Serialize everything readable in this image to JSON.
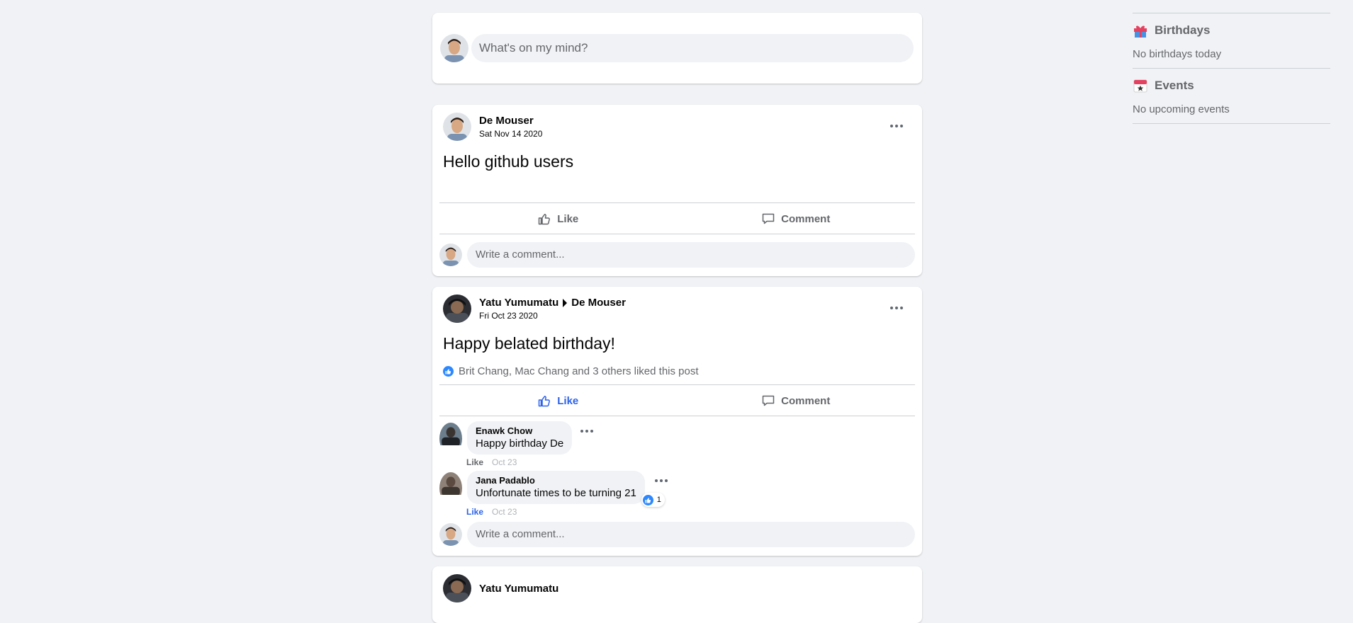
{
  "composer": {
    "placeholder": "What's on my mind?"
  },
  "posts": [
    {
      "author": "De Mouser",
      "date": "Sat Nov 14 2020",
      "text": "Hello github users",
      "actions": {
        "like": "Like",
        "comment": "Comment"
      },
      "comment_placeholder": "Write a comment..."
    },
    {
      "author": "Yatu Yumumatu",
      "target": "De Mouser",
      "date": "Fri Oct 23 2020",
      "text": "Happy belated birthday!",
      "likes_summary": "Brit Chang, Mac Chang and 3 others liked this post",
      "actions": {
        "like": "Like",
        "comment": "Comment"
      },
      "comments": [
        {
          "name": "Enawk Chow",
          "text": "Happy birthday De",
          "like": "Like",
          "date": "Oct 23"
        },
        {
          "name": "Jana Padablo",
          "text": "Unfortunate times to be turning 21",
          "like": "Like",
          "date": "Oct 23",
          "reactions": "1"
        }
      ],
      "comment_placeholder": "Write a comment..."
    },
    {
      "author": "Yatu Yumumatu"
    }
  ],
  "sidebar": {
    "birthdays": {
      "title": "Birthdays",
      "subtitle": "No birthdays today"
    },
    "events": {
      "title": "Events",
      "subtitle": "No upcoming events"
    }
  },
  "colors": {
    "background": "#f0f2f5",
    "accent": "#2d63e8",
    "like_badge": "#2d88ff"
  }
}
